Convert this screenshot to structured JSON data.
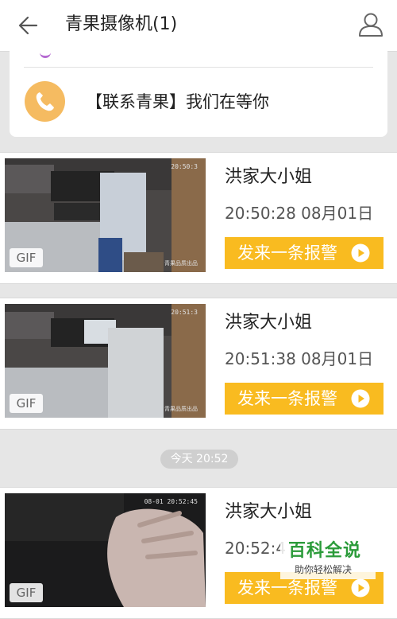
{
  "header": {
    "title": "青果摄像机(1)",
    "back_icon": "arrow-left-icon",
    "user_icon": "user-icon"
  },
  "contact": {
    "text": "【联系青果】我们在等你",
    "icon": "phone-icon",
    "icon_color": "#f5bb61"
  },
  "messages": [
    {
      "sender": "洪家大小姐",
      "time": "20:50:28 08月01日",
      "gif_label": "GIF",
      "cam_timestamp": "20:50:3",
      "action_label": "发来一条报警"
    },
    {
      "sender": "洪家大小姐",
      "time": "20:51:38 08月01日",
      "gif_label": "GIF",
      "cam_timestamp": "20:51:3",
      "action_label": "发来一条报警"
    },
    {
      "sender": "洪家大小姐",
      "time": "20:52:4",
      "gif_label": "GIF",
      "cam_timestamp": "08-01 20:52:45",
      "action_label": "发来一条报警"
    }
  ],
  "divider_time": "今天 20:52",
  "watermark": {
    "logo": "百科全说",
    "subtitle": "助你轻松解决"
  },
  "colors": {
    "accent": "#f9bb20",
    "background": "#e6e6e6"
  }
}
